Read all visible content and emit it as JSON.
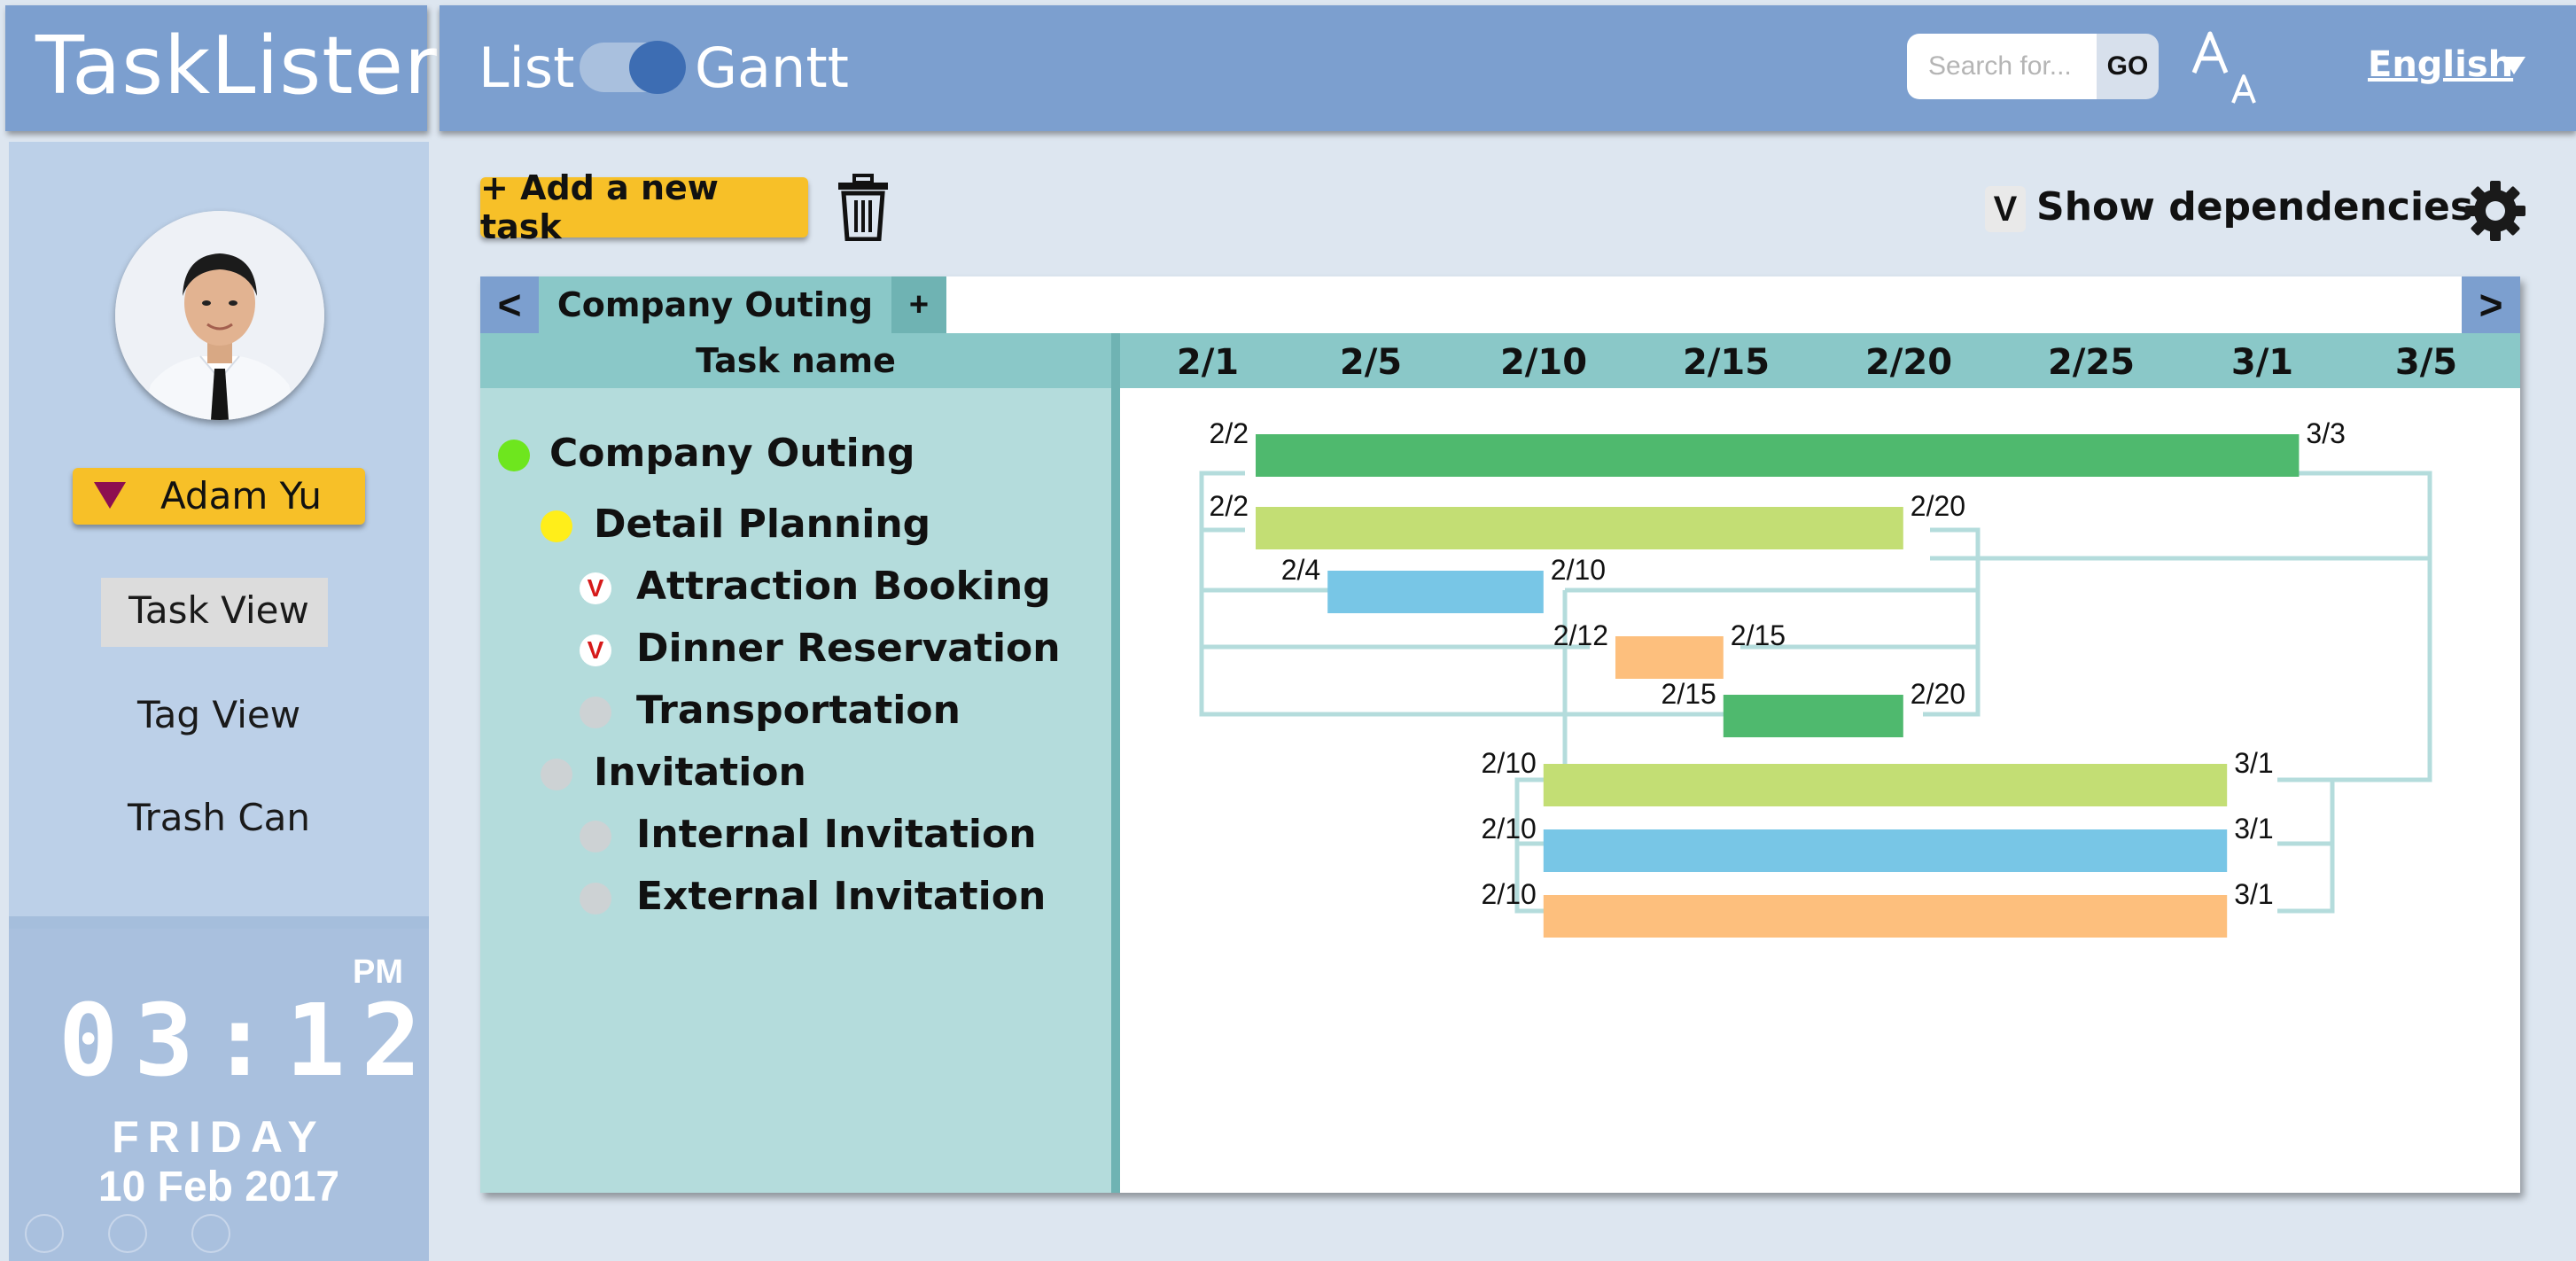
{
  "app": {
    "title": "TaskLister"
  },
  "header": {
    "view_list": "List",
    "view_gantt": "Gantt",
    "search_placeholder": "Search for...",
    "search_go": "GO",
    "language": "English"
  },
  "sidebar": {
    "user_name": "Adam Yu",
    "nav": [
      "Task View",
      "Tag View",
      "Trash Can"
    ],
    "clock": {
      "time": "03:12",
      "ampm": "PM",
      "day": "FRIDAY",
      "date": "10 Feb 2017"
    }
  },
  "toolbar": {
    "add_task": "+ Add a new task",
    "show_dependencies_check": "V",
    "show_dependencies": "Show dependencies"
  },
  "tabs": {
    "prev": "<",
    "current": "Company Outing",
    "add": "+",
    "next": ">"
  },
  "table": {
    "task_name_header": "Task name"
  },
  "dates": [
    "2/1",
    "2/5",
    "2/10",
    "2/15",
    "2/20",
    "2/25",
    "3/1",
    "3/5"
  ],
  "tasks": [
    {
      "name": "Company Outing",
      "indent": 0,
      "marker": "green-dot"
    },
    {
      "name": "Detail Planning",
      "indent": 1,
      "marker": "yellow-dot"
    },
    {
      "name": "Attraction Booking",
      "indent": 2,
      "marker": "check-v",
      "check": "V"
    },
    {
      "name": "Dinner Reservation",
      "indent": 2,
      "marker": "check-v",
      "check": "V"
    },
    {
      "name": "Transportation",
      "indent": 2,
      "marker": "gray-dot"
    },
    {
      "name": "Invitation",
      "indent": 1,
      "marker": "gray-dot"
    },
    {
      "name": "Internal Invitation",
      "indent": 2,
      "marker": "gray-dot"
    },
    {
      "name": "External Invitation",
      "indent": 2,
      "marker": "gray-dot"
    }
  ],
  "bars": [
    {
      "task": "Company Outing",
      "start": "2/2",
      "end": "3/3",
      "color": "#4fb96e"
    },
    {
      "task": "Detail Planning",
      "start": "2/2",
      "end": "2/20",
      "color": "#c3de74"
    },
    {
      "task": "Attraction Booking",
      "start": "2/4",
      "end": "2/10",
      "color": "#78c6e6"
    },
    {
      "task": "Dinner Reservation",
      "start": "2/12",
      "end": "2/15",
      "color": "#fdbf7d"
    },
    {
      "task": "Transportation",
      "start": "2/15",
      "end": "2/20",
      "color": "#4fb96e"
    },
    {
      "task": "Invitation",
      "start": "2/10",
      "end": "3/1",
      "color": "#c3de74"
    },
    {
      "task": "Internal Invitation",
      "start": "2/10",
      "end": "3/1",
      "color": "#78c6e6"
    },
    {
      "task": "External Invitation",
      "start": "2/10",
      "end": "3/1",
      "color": "#fdbf7d"
    }
  ],
  "colors": {
    "header_blue": "#7c9fcf",
    "sidebar_blue": "#bcd0e8",
    "accent_yellow": "#f7c028",
    "teal_header": "#8ac8c8",
    "teal_column": "#b4dcdc",
    "dependency_line": "#b4dcdc"
  }
}
